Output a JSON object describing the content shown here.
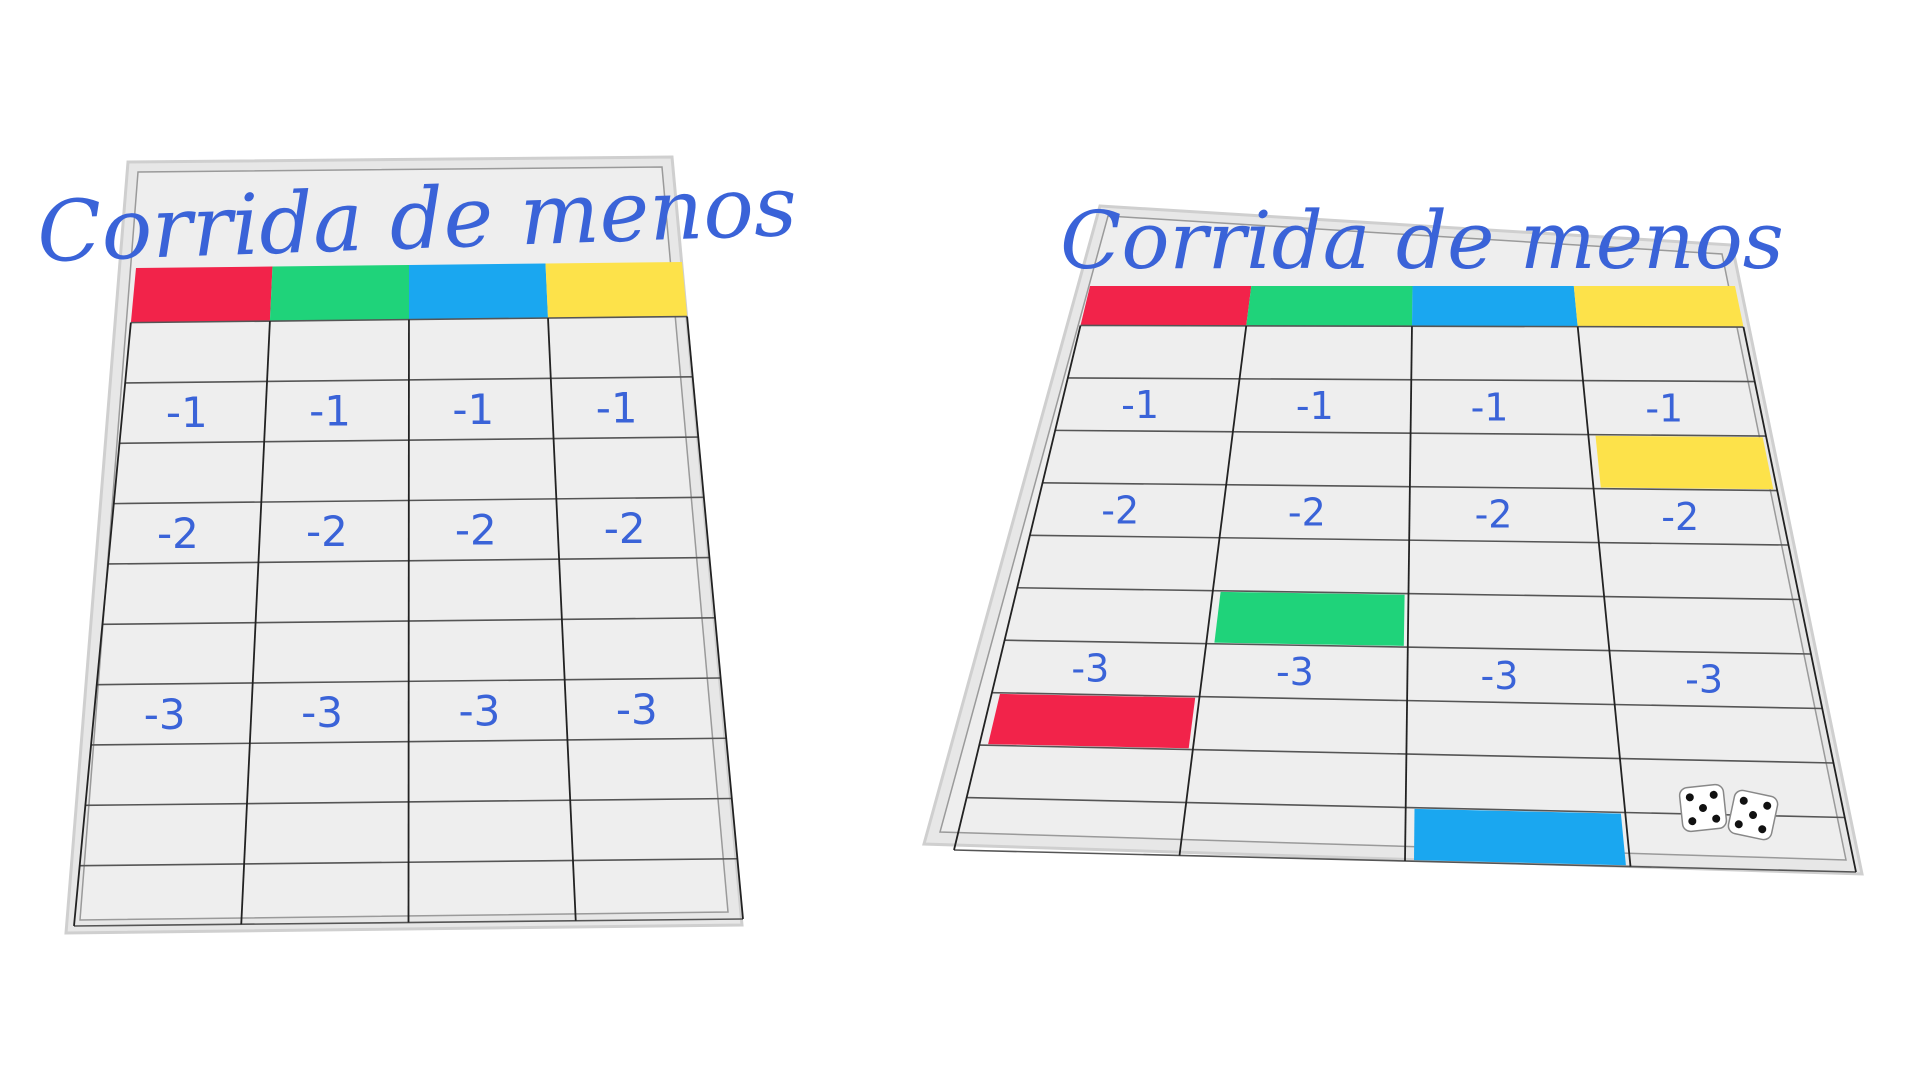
{
  "boards": [
    {
      "title": "Corrida de menos",
      "header_colors": [
        "#f2234a",
        "#1fd37a",
        "#1aa7f0",
        "#fde24a"
      ],
      "rows": [
        [
          "",
          "",
          "",
          ""
        ],
        [
          "-1",
          "-1",
          "-1",
          "-1"
        ],
        [
          "",
          "",
          "",
          ""
        ],
        [
          "-2",
          "-2",
          "-2",
          "-2"
        ],
        [
          "",
          "",
          "",
          ""
        ],
        [
          "",
          "",
          "",
          ""
        ],
        [
          "-3",
          "-3",
          "-3",
          "-3"
        ],
        [
          "",
          "",
          "",
          ""
        ],
        [
          "",
          "",
          "",
          ""
        ],
        [
          "",
          "",
          "",
          ""
        ]
      ]
    },
    {
      "title": "Corrida de menos",
      "header_colors": [
        "#f2234a",
        "#1fd37a",
        "#1aa7f0",
        "#fde24a"
      ],
      "rows": [
        [
          "",
          "",
          "",
          ""
        ],
        [
          "-1",
          "-1",
          "-1",
          "-1"
        ],
        [
          "",
          "",
          "",
          ""
        ],
        [
          "-2",
          "-2",
          "-2",
          "-2"
        ],
        [
          "",
          "",
          "",
          ""
        ],
        [
          "",
          "",
          "",
          ""
        ],
        [
          "-3",
          "-3",
          "-3",
          "-3"
        ],
        [
          "",
          "",
          "",
          ""
        ],
        [
          "",
          "",
          "",
          ""
        ],
        [
          "",
          "",
          "",
          ""
        ]
      ],
      "pieces": [
        {
          "color": "#fde24a",
          "column": 4,
          "row": 3
        },
        {
          "color": "#1fd37a",
          "column": 2,
          "row": 6
        },
        {
          "color": "#f2234a",
          "column": 1,
          "row": 8
        },
        {
          "color": "#1aa7f0",
          "column": 3,
          "row": 10
        }
      ],
      "dice": [
        {
          "name": "die-left",
          "value": 5
        },
        {
          "name": "die-right",
          "value": 5
        }
      ]
    }
  ],
  "colors": {
    "board_surface": "#e7e7e7",
    "board_edge": "#cfcfcf",
    "grid_line": "#222222",
    "ink": "#3a63d8"
  }
}
